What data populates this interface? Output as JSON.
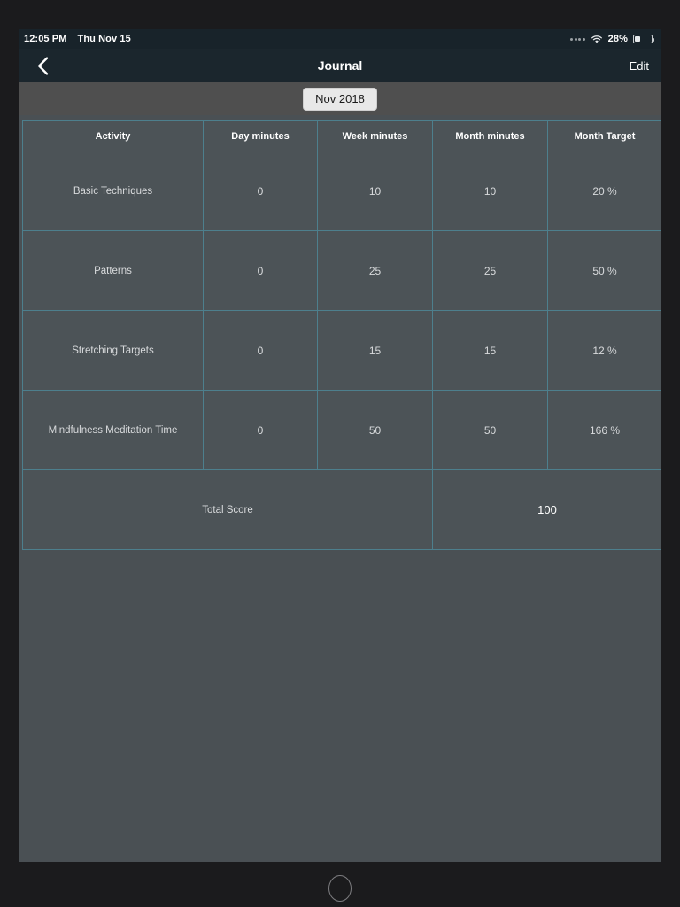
{
  "status_bar": {
    "time": "12:05 PM",
    "date": "Thu Nov 15",
    "battery_percent": "28%",
    "icons": {
      "signal": "signal-dots-icon",
      "wifi": "wifi-icon",
      "battery": "battery-icon"
    }
  },
  "nav_bar": {
    "back_icon": "chevron-left-icon",
    "title": "Journal",
    "edit_label": "Edit"
  },
  "month_selector": {
    "label": "Nov 2018"
  },
  "table": {
    "headers": [
      "Activity",
      "Day minutes",
      "Week minutes",
      "Month minutes",
      "Month Target"
    ],
    "rows": [
      {
        "activity": "Basic Techniques",
        "day": "0",
        "week": "10",
        "month": "10",
        "target": "20 %"
      },
      {
        "activity": "Patterns",
        "day": "0",
        "week": "25",
        "month": "25",
        "target": "50 %"
      },
      {
        "activity": "Stretching Targets",
        "day": "0",
        "week": "15",
        "month": "15",
        "target": "12 %"
      },
      {
        "activity": "Mindfulness Meditation Time",
        "day": "0",
        "week": "50",
        "month": "50",
        "target": "166 %"
      }
    ],
    "total": {
      "label": "Total Score",
      "value": "100"
    }
  },
  "device": {
    "home_button": "home-button"
  },
  "colors": {
    "bezel": "#1b1b1d",
    "status_bar_bg": "#18232a",
    "nav_bar_bg": "#1b262d",
    "month_strip_bg": "#4f4f4f",
    "content_bg": "#4a5054",
    "cell_bg": "#4c5357",
    "grid_line": "#4d7f8d",
    "text_primary": "#ffffff",
    "text_secondary": "#d8dadc",
    "chip_bg": "#e8e8e8"
  }
}
